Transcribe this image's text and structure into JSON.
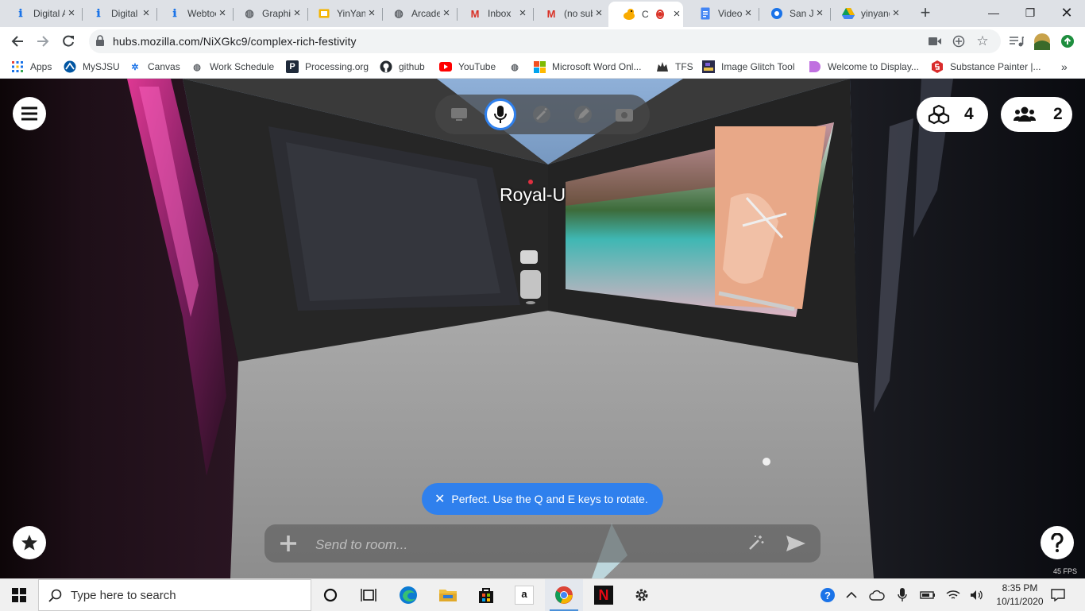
{
  "browser": {
    "tabs": [
      {
        "title": "Digital Art",
        "icon": "info-i-icon",
        "color": "#1a73e8"
      },
      {
        "title": "Digital Art",
        "icon": "info-i-icon",
        "color": "#1a73e8"
      },
      {
        "title": "Webtoon",
        "icon": "info-i-icon",
        "color": "#1a73e8"
      },
      {
        "title": "Graphics",
        "icon": "globe-icon",
        "color": "#5f6368"
      },
      {
        "title": "YinYang",
        "icon": "slides-icon",
        "color": "#f4b400"
      },
      {
        "title": "Arcade",
        "icon": "globe-icon",
        "color": "#5f6368"
      },
      {
        "title": "Inbox",
        "icon": "gmail-icon",
        "color": "#d93025"
      },
      {
        "title": "(no subject)",
        "icon": "gmail-icon",
        "color": "#d93025"
      },
      {
        "title": "C",
        "icon": "duck-icon",
        "color": "#f9ab00",
        "active": true,
        "recording": true
      },
      {
        "title": "Video",
        "icon": "docs-icon",
        "color": "#4285f4"
      },
      {
        "title": "San Jose",
        "icon": "circle-o-icon",
        "color": "#1a73e8"
      },
      {
        "title": "yinyang",
        "icon": "drive-icon",
        "color": "#0f9d58"
      }
    ],
    "url": "hubs.mozilla.com/NiXGkc9/complex-rich-festivity",
    "bookmarks": [
      {
        "label": "Apps",
        "icon": "apps-grid-icon"
      },
      {
        "label": "MySJSU",
        "icon": "sjsu-icon"
      },
      {
        "label": "Canvas",
        "icon": "canvas-icon"
      },
      {
        "label": "Work Schedule",
        "icon": "globe-icon"
      },
      {
        "label": "Processing.org",
        "icon": "processing-icon"
      },
      {
        "label": "github",
        "icon": "github-icon"
      },
      {
        "label": "YouTube",
        "icon": "youtube-icon"
      },
      {
        "label": "",
        "icon": "globe-icon"
      },
      {
        "label": "Microsoft Word Onl...",
        "icon": "microsoft-icon"
      },
      {
        "label": "TFS",
        "icon": "tfs-icon"
      },
      {
        "label": "Image Glitch Tool",
        "icon": "glitch-icon"
      },
      {
        "label": "Welcome to Display...",
        "icon": "display-icon"
      },
      {
        "label": "Substance Painter |...",
        "icon": "substance-icon"
      }
    ]
  },
  "hubs": {
    "object_count": "4",
    "people_count": "2",
    "avatar_name": "Royal-U",
    "toast_message": "Perfect. Use the Q and E keys to rotate.",
    "chat_placeholder": "Send to room...",
    "fps": "45 FPS",
    "media_buttons": [
      "screen-share-icon",
      "microphone-icon",
      "magic-wand-icon",
      "pen-icon",
      "camera-icon"
    ],
    "active_media_button": "microphone-icon",
    "accent": "#2f80ed"
  },
  "taskbar": {
    "search_placeholder": "Type here to search",
    "time": "8:35 PM",
    "date": "10/11/2020"
  }
}
